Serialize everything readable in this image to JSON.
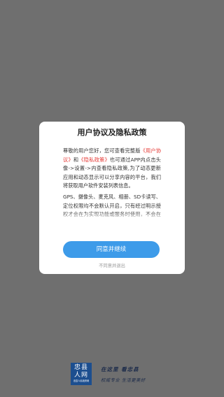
{
  "dialog": {
    "title": "用户协议及隐私政策",
    "body": {
      "p1_before": "尊敬的用户您好，您可查看完整版",
      "link_user_agreement": "《用户协议》",
      "p1_and": "和",
      "link_privacy_policy": "《隐私政策》",
      "p1_after": "也可通过APP内点击头像->设置->内查看隐私政策,为了动态更新应用和动态显示可以分享内容的平台，我们将获取用户软件安装列表信息。",
      "p2": "GPS、摄像头、麦克风、相册、SD卡读写、定位权限均不会默认开启，只有经过明示授权才会在为实现功能或服务时使用，不会在功能或服务不需要时而通过您授权的权限收集信息。"
    },
    "agree_button": "同意并继续",
    "decline_link": "不同意并退出"
  },
  "footer": {
    "logo": {
      "line1": "忠县",
      "line2": "人网",
      "line3": "忠县人民政府网"
    },
    "slogan_line1": "在这里  看忠县",
    "slogan_line2": "权威专业 生活更美好"
  }
}
